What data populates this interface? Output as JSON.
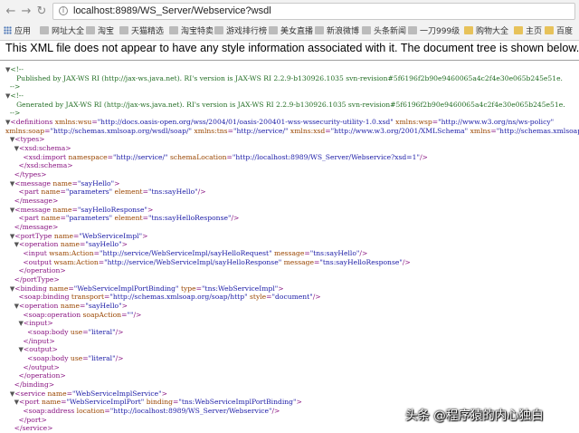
{
  "browser": {
    "url": "localhost:8989/WS_Server/Webservice?wsdl",
    "bookmarks": [
      "应用",
      "网址大全",
      "淘宝",
      "天猫精选",
      "淘宝特卖",
      "游戏排行榜",
      "美女直播",
      "新浪微博",
      "头条新闻",
      "一刀999级",
      "购物大全",
      "主页",
      "百度"
    ]
  },
  "notice": "This XML file does not appear to have any style information associated with it. The document tree is shown below.",
  "xml_lines": [
    [
      {
        "t": "tri",
        "v": "▼"
      },
      {
        "t": "cm",
        "v": "<!--"
      }
    ],
    [
      {
        "t": "cm",
        "v": "     Published by JAX-WS RI (http://jax-ws.java.net). RI's version is JAX-WS RI 2.2.9-b130926.1035 svn-revision#5f6196f2b90e9460065a4c2f4e30e065b245e51e."
      }
    ],
    [
      {
        "t": "cm",
        "v": "  -->"
      }
    ],
    [
      {
        "t": "tri",
        "v": "▼"
      },
      {
        "t": "cm",
        "v": "<!--"
      }
    ],
    [
      {
        "t": "cm",
        "v": "     Generated by JAX-WS RI (http://jax-ws.java.net). RI's version is JAX-WS RI 2.2.9-b130926.1035 svn-revision#5f6196f2b90e9460065a4c2f4e30e065b245e51e."
      }
    ],
    [
      {
        "t": "cm",
        "v": "  -->"
      }
    ],
    [
      {
        "t": "tri",
        "v": "▼"
      },
      {
        "t": "tag",
        "v": "<definitions"
      },
      {
        "t": "an",
        "v": " xmlns:wsu"
      },
      {
        "t": "tag",
        "v": "="
      },
      {
        "t": "av",
        "v": "\"http://docs.oasis-open.org/wss/2004/01/oasis-200401-wss-wssecurity-utility-1.0.xsd\""
      },
      {
        "t": "an",
        "v": " xmlns:wsp"
      },
      {
        "t": "tag",
        "v": "="
      },
      {
        "t": "av",
        "v": "\"http://www.w3.org/ns/ws-policy\""
      }
    ],
    [
      {
        "t": "an",
        "v": "xmlns:soap"
      },
      {
        "t": "tag",
        "v": "="
      },
      {
        "t": "av",
        "v": "\"http://schemas.xmlsoap.org/wsdl/soap/\""
      },
      {
        "t": "an",
        "v": " xmlns:tns"
      },
      {
        "t": "tag",
        "v": "="
      },
      {
        "t": "av",
        "v": "\"http://service/\""
      },
      {
        "t": "an",
        "v": " xmlns:xsd"
      },
      {
        "t": "tag",
        "v": "="
      },
      {
        "t": "av",
        "v": "\"http://www.w3.org/2001/XMLSchema\""
      },
      {
        "t": "an",
        "v": " xmlns"
      },
      {
        "t": "tag",
        "v": "="
      },
      {
        "t": "av",
        "v": "\"http://schemas.xmlsoap.org/wsdl/\""
      }
    ],
    [
      {
        "t": "tx",
        "v": "  "
      },
      {
        "t": "tri",
        "v": "▼"
      },
      {
        "t": "tag",
        "v": "<types>"
      }
    ],
    [
      {
        "t": "tx",
        "v": "    "
      },
      {
        "t": "tri",
        "v": "▼"
      },
      {
        "t": "tag",
        "v": "<xsd:schema>"
      }
    ],
    [
      {
        "t": "tx",
        "v": "        "
      },
      {
        "t": "tag",
        "v": "<xsd:import"
      },
      {
        "t": "an",
        "v": " namespace"
      },
      {
        "t": "tag",
        "v": "="
      },
      {
        "t": "av",
        "v": "\"http://service/\""
      },
      {
        "t": "an",
        "v": " schemaLocation"
      },
      {
        "t": "tag",
        "v": "="
      },
      {
        "t": "av",
        "v": "\"http://localhost:8989/WS_Server/Webservice?xsd=1\""
      },
      {
        "t": "tag",
        "v": "/>"
      }
    ],
    [
      {
        "t": "tx",
        "v": "      "
      },
      {
        "t": "tag",
        "v": "</xsd:schema>"
      }
    ],
    [
      {
        "t": "tx",
        "v": "    "
      },
      {
        "t": "tag",
        "v": "</types>"
      }
    ],
    [
      {
        "t": "tx",
        "v": "  "
      },
      {
        "t": "tri",
        "v": "▼"
      },
      {
        "t": "tag",
        "v": "<message"
      },
      {
        "t": "an",
        "v": " name"
      },
      {
        "t": "tag",
        "v": "="
      },
      {
        "t": "av",
        "v": "\"sayHello\""
      },
      {
        "t": "tag",
        "v": ">"
      }
    ],
    [
      {
        "t": "tx",
        "v": "      "
      },
      {
        "t": "tag",
        "v": "<part"
      },
      {
        "t": "an",
        "v": " name"
      },
      {
        "t": "tag",
        "v": "="
      },
      {
        "t": "av",
        "v": "\"parameters\""
      },
      {
        "t": "an",
        "v": " element"
      },
      {
        "t": "tag",
        "v": "="
      },
      {
        "t": "av",
        "v": "\"tns:sayHello\""
      },
      {
        "t": "tag",
        "v": "/>"
      }
    ],
    [
      {
        "t": "tx",
        "v": "    "
      },
      {
        "t": "tag",
        "v": "</message>"
      }
    ],
    [
      {
        "t": "tx",
        "v": "  "
      },
      {
        "t": "tri",
        "v": "▼"
      },
      {
        "t": "tag",
        "v": "<message"
      },
      {
        "t": "an",
        "v": " name"
      },
      {
        "t": "tag",
        "v": "="
      },
      {
        "t": "av",
        "v": "\"sayHelloResponse\""
      },
      {
        "t": "tag",
        "v": ">"
      }
    ],
    [
      {
        "t": "tx",
        "v": "      "
      },
      {
        "t": "tag",
        "v": "<part"
      },
      {
        "t": "an",
        "v": " name"
      },
      {
        "t": "tag",
        "v": "="
      },
      {
        "t": "av",
        "v": "\"parameters\""
      },
      {
        "t": "an",
        "v": " element"
      },
      {
        "t": "tag",
        "v": "="
      },
      {
        "t": "av",
        "v": "\"tns:sayHelloResponse\""
      },
      {
        "t": "tag",
        "v": "/>"
      }
    ],
    [
      {
        "t": "tx",
        "v": "    "
      },
      {
        "t": "tag",
        "v": "</message>"
      }
    ],
    [
      {
        "t": "tx",
        "v": "  "
      },
      {
        "t": "tri",
        "v": "▼"
      },
      {
        "t": "tag",
        "v": "<portType"
      },
      {
        "t": "an",
        "v": " name"
      },
      {
        "t": "tag",
        "v": "="
      },
      {
        "t": "av",
        "v": "\"WebServiceImpl\""
      },
      {
        "t": "tag",
        "v": ">"
      }
    ],
    [
      {
        "t": "tx",
        "v": "    "
      },
      {
        "t": "tri",
        "v": "▼"
      },
      {
        "t": "tag",
        "v": "<operation"
      },
      {
        "t": "an",
        "v": " name"
      },
      {
        "t": "tag",
        "v": "="
      },
      {
        "t": "av",
        "v": "\"sayHello\""
      },
      {
        "t": "tag",
        "v": ">"
      }
    ],
    [
      {
        "t": "tx",
        "v": "        "
      },
      {
        "t": "tag",
        "v": "<input"
      },
      {
        "t": "an",
        "v": " wsam:Action"
      },
      {
        "t": "tag",
        "v": "="
      },
      {
        "t": "av",
        "v": "\"http://service/WebServiceImpl/sayHelloRequest\""
      },
      {
        "t": "an",
        "v": " message"
      },
      {
        "t": "tag",
        "v": "="
      },
      {
        "t": "av",
        "v": "\"tns:sayHello\""
      },
      {
        "t": "tag",
        "v": "/>"
      }
    ],
    [
      {
        "t": "tx",
        "v": "        "
      },
      {
        "t": "tag",
        "v": "<output"
      },
      {
        "t": "an",
        "v": " wsam:Action"
      },
      {
        "t": "tag",
        "v": "="
      },
      {
        "t": "av",
        "v": "\"http://service/WebServiceImpl/sayHelloResponse\""
      },
      {
        "t": "an",
        "v": " message"
      },
      {
        "t": "tag",
        "v": "="
      },
      {
        "t": "av",
        "v": "\"tns:sayHelloResponse\""
      },
      {
        "t": "tag",
        "v": "/>"
      }
    ],
    [
      {
        "t": "tx",
        "v": "      "
      },
      {
        "t": "tag",
        "v": "</operation>"
      }
    ],
    [
      {
        "t": "tx",
        "v": "    "
      },
      {
        "t": "tag",
        "v": "</portType>"
      }
    ],
    [
      {
        "t": "tx",
        "v": "  "
      },
      {
        "t": "tri",
        "v": "▼"
      },
      {
        "t": "tag",
        "v": "<binding"
      },
      {
        "t": "an",
        "v": " name"
      },
      {
        "t": "tag",
        "v": "="
      },
      {
        "t": "av",
        "v": "\"WebServiceImplPortBinding\""
      },
      {
        "t": "an",
        "v": " type"
      },
      {
        "t": "tag",
        "v": "="
      },
      {
        "t": "av",
        "v": "\"tns:WebServiceImpl\""
      },
      {
        "t": "tag",
        "v": ">"
      }
    ],
    [
      {
        "t": "tx",
        "v": "      "
      },
      {
        "t": "tag",
        "v": "<soap:binding"
      },
      {
        "t": "an",
        "v": " transport"
      },
      {
        "t": "tag",
        "v": "="
      },
      {
        "t": "av",
        "v": "\"http://schemas.xmlsoap.org/soap/http\""
      },
      {
        "t": "an",
        "v": " style"
      },
      {
        "t": "tag",
        "v": "="
      },
      {
        "t": "av",
        "v": "\"document\""
      },
      {
        "t": "tag",
        "v": "/>"
      }
    ],
    [
      {
        "t": "tx",
        "v": "    "
      },
      {
        "t": "tri",
        "v": "▼"
      },
      {
        "t": "tag",
        "v": "<operation"
      },
      {
        "t": "an",
        "v": " name"
      },
      {
        "t": "tag",
        "v": "="
      },
      {
        "t": "av",
        "v": "\"sayHello\""
      },
      {
        "t": "tag",
        "v": ">"
      }
    ],
    [
      {
        "t": "tx",
        "v": "        "
      },
      {
        "t": "tag",
        "v": "<soap:operation"
      },
      {
        "t": "an",
        "v": " soapAction"
      },
      {
        "t": "tag",
        "v": "="
      },
      {
        "t": "av",
        "v": "\"\""
      },
      {
        "t": "tag",
        "v": "/>"
      }
    ],
    [
      {
        "t": "tx",
        "v": "      "
      },
      {
        "t": "tri",
        "v": "▼"
      },
      {
        "t": "tag",
        "v": "<input>"
      }
    ],
    [
      {
        "t": "tx",
        "v": "          "
      },
      {
        "t": "tag",
        "v": "<soap:body"
      },
      {
        "t": "an",
        "v": " use"
      },
      {
        "t": "tag",
        "v": "="
      },
      {
        "t": "av",
        "v": "\"literal\""
      },
      {
        "t": "tag",
        "v": "/>"
      }
    ],
    [
      {
        "t": "tx",
        "v": "        "
      },
      {
        "t": "tag",
        "v": "</input>"
      }
    ],
    [
      {
        "t": "tx",
        "v": "      "
      },
      {
        "t": "tri",
        "v": "▼"
      },
      {
        "t": "tag",
        "v": "<output>"
      }
    ],
    [
      {
        "t": "tx",
        "v": "          "
      },
      {
        "t": "tag",
        "v": "<soap:body"
      },
      {
        "t": "an",
        "v": " use"
      },
      {
        "t": "tag",
        "v": "="
      },
      {
        "t": "av",
        "v": "\"literal\""
      },
      {
        "t": "tag",
        "v": "/>"
      }
    ],
    [
      {
        "t": "tx",
        "v": "        "
      },
      {
        "t": "tag",
        "v": "</output>"
      }
    ],
    [
      {
        "t": "tx",
        "v": "      "
      },
      {
        "t": "tag",
        "v": "</operation>"
      }
    ],
    [
      {
        "t": "tx",
        "v": "    "
      },
      {
        "t": "tag",
        "v": "</binding>"
      }
    ],
    [
      {
        "t": "tx",
        "v": "  "
      },
      {
        "t": "tri",
        "v": "▼"
      },
      {
        "t": "tag",
        "v": "<service"
      },
      {
        "t": "an",
        "v": " name"
      },
      {
        "t": "tag",
        "v": "="
      },
      {
        "t": "av",
        "v": "\"WebServiceImplService\""
      },
      {
        "t": "tag",
        "v": ">"
      }
    ],
    [
      {
        "t": "tx",
        "v": "    "
      },
      {
        "t": "tri",
        "v": "▼"
      },
      {
        "t": "tag",
        "v": "<port"
      },
      {
        "t": "an",
        "v": " name"
      },
      {
        "t": "tag",
        "v": "="
      },
      {
        "t": "av",
        "v": "\"WebServiceImplPort\""
      },
      {
        "t": "an",
        "v": " binding"
      },
      {
        "t": "tag",
        "v": "="
      },
      {
        "t": "av",
        "v": "\"tns:WebServiceImplPortBinding\""
      },
      {
        "t": "tag",
        "v": ">"
      }
    ],
    [
      {
        "t": "tx",
        "v": "        "
      },
      {
        "t": "tag",
        "v": "<soap:address"
      },
      {
        "t": "an",
        "v": " location"
      },
      {
        "t": "tag",
        "v": "="
      },
      {
        "t": "av",
        "v": "\"http://localhost:8989/WS_Server/Webservice\""
      },
      {
        "t": "tag",
        "v": "/>"
      }
    ],
    [
      {
        "t": "tx",
        "v": "      "
      },
      {
        "t": "tag",
        "v": "</port>"
      }
    ],
    [
      {
        "t": "tx",
        "v": "    "
      },
      {
        "t": "tag",
        "v": "</service>"
      }
    ]
  ],
  "watermark": "头条 @程序猿的内心独白"
}
